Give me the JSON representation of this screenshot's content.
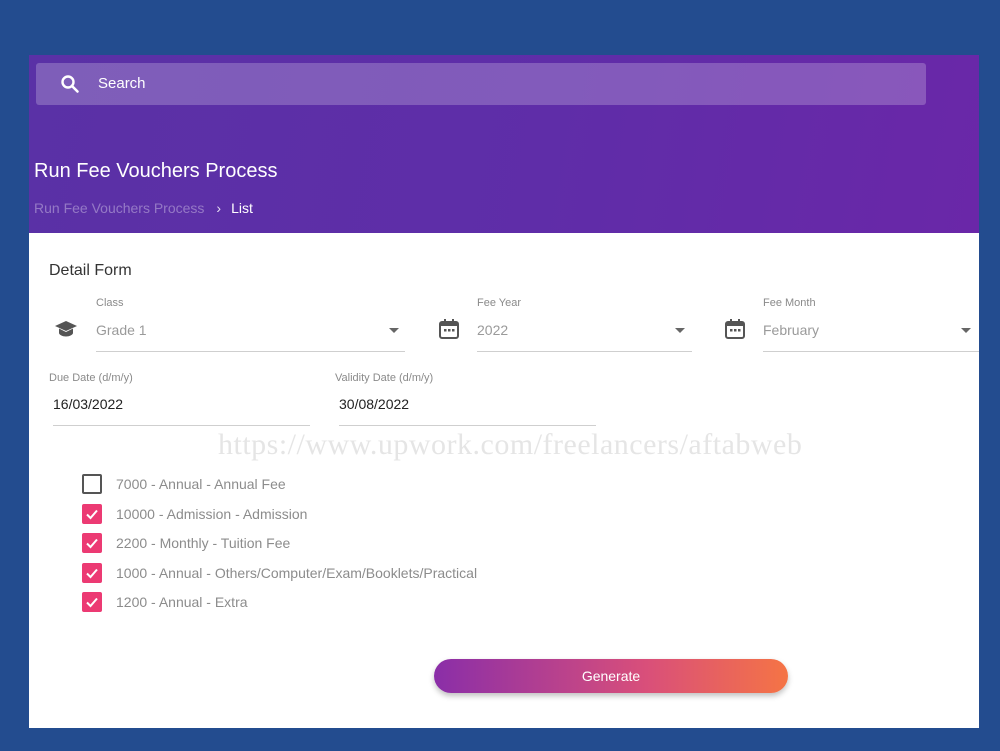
{
  "search": {
    "label": "Search",
    "icon": "search-icon"
  },
  "header": {
    "title": "Run Fee Vouchers Process",
    "breadcrumb": {
      "parent": "Run Fee Vouchers Process",
      "separator": "›",
      "current": "List"
    }
  },
  "form": {
    "title": "Detail Form",
    "class_field": {
      "label": "Class",
      "value": "Grade 1",
      "icon": "graduation-cap-icon"
    },
    "fee_year": {
      "label": "Fee Year",
      "value": "2022",
      "icon": "calendar-icon"
    },
    "fee_month": {
      "label": "Fee Month",
      "value": "February",
      "icon": "calendar-icon"
    },
    "due_date": {
      "label": "Due Date (d/m/y)",
      "value": "16/03/2022"
    },
    "validity_date": {
      "label": "Validity Date (d/m/y)",
      "value": "30/08/2022"
    }
  },
  "fees": [
    {
      "label": "7000 - Annual - Annual Fee",
      "checked": false
    },
    {
      "label": "10000 - Admission - Admission",
      "checked": true
    },
    {
      "label": "2200 - Monthly - Tuition Fee",
      "checked": true
    },
    {
      "label": "1000 - Annual - Others/Computer/Exam/Booklets/Practical",
      "checked": true
    },
    {
      "label": "1200 - Annual - Extra",
      "checked": true
    }
  ],
  "watermark": "https://www.upwork.com/freelancers/aftabweb",
  "generate_label": "Generate",
  "colors": {
    "background": "#234c8f",
    "header": "#5f2da8",
    "checkbox": "#ec3a73",
    "button_start": "#8a2ea8",
    "button_end": "#f57445"
  }
}
